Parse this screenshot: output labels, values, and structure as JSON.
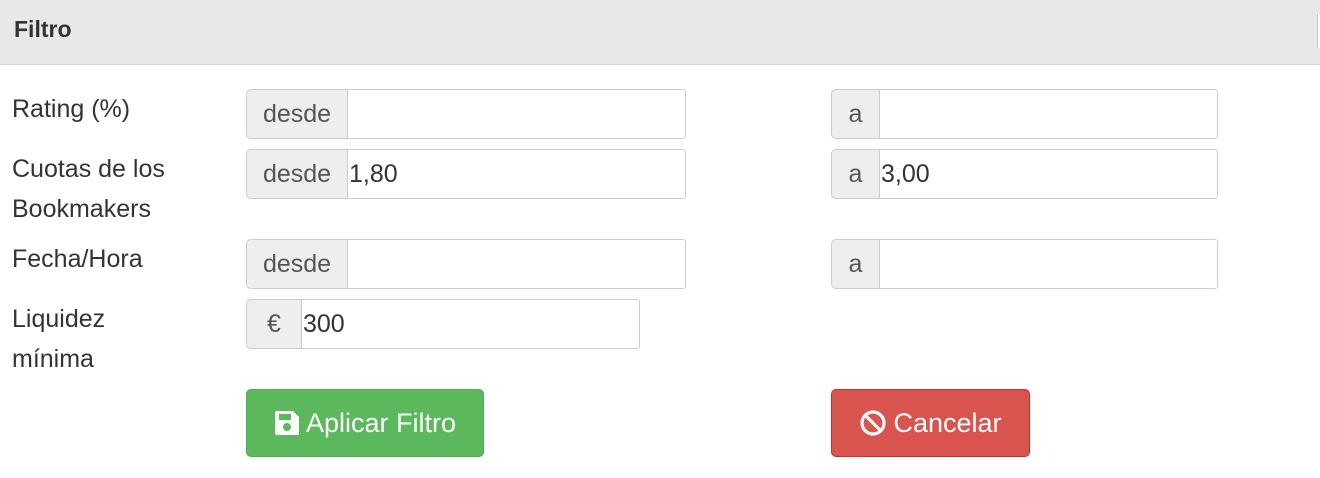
{
  "panel": {
    "title": "Filtro"
  },
  "rows": {
    "rating": {
      "label": "Rating (%)",
      "from_addon": "desde",
      "from_value": "",
      "to_addon": "a",
      "to_value": ""
    },
    "odds": {
      "label_line1": "Cuotas de los",
      "label_line2": "Bookmakers",
      "from_addon": "desde",
      "from_value": "1,80",
      "to_addon": "a",
      "to_value": "3,00"
    },
    "datetime": {
      "label": "Fecha/Hora",
      "from_addon": "desde",
      "from_value": "",
      "to_addon": "a",
      "to_value": ""
    },
    "liquidity": {
      "label_line1": "Liquidez",
      "label_line2": "mínima",
      "addon": "€",
      "value": "300"
    }
  },
  "buttons": {
    "apply": {
      "label": "Aplicar Filtro",
      "icon": "floppy-disk-icon",
      "color": "#5cb85c"
    },
    "cancel": {
      "label": "Cancelar",
      "icon": "ban-icon",
      "color": "#d9534f"
    }
  }
}
